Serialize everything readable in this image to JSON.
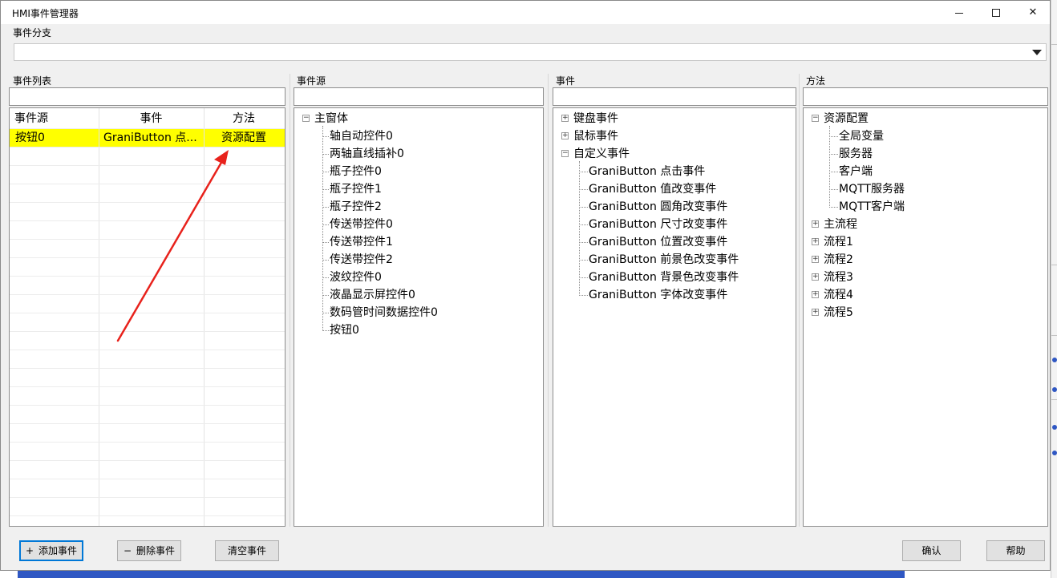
{
  "window": {
    "title": "HMI事件管理器",
    "minimize_icon": "minimize-icon",
    "maximize_icon": "maximize-icon",
    "close_icon": "close-icon",
    "close_glyph": "✕"
  },
  "branch": {
    "label": "事件分支",
    "value": ""
  },
  "event_list": {
    "label": "事件列表",
    "filter_value": "",
    "columns": [
      "事件源",
      "事件",
      "方法"
    ],
    "rows": [
      [
        "按钮0",
        "GraniButton 点...",
        "资源配置"
      ]
    ],
    "selected_row_color": "#ffff00"
  },
  "source": {
    "label": "事件源",
    "filter_value": "",
    "root": "主窗体",
    "root_expander": "−",
    "children": [
      "轴自动控件0",
      "两轴直线插补0",
      "瓶子控件0",
      "瓶子控件1",
      "瓶子控件2",
      "传送带控件0",
      "传送带控件1",
      "传送带控件2",
      "波纹控件0",
      "液晶显示屏控件0",
      "数码管时间数据控件0",
      "按钮0"
    ]
  },
  "events": {
    "label": "事件",
    "filter_value": "",
    "groups": [
      {
        "label": "键盘事件",
        "expander": "+"
      },
      {
        "label": "鼠标事件",
        "expander": "+"
      },
      {
        "label": "自定义事件",
        "expander": "−"
      }
    ],
    "custom_children": [
      "GraniButton 点击事件",
      "GraniButton 值改变事件",
      "GraniButton 圆角改变事件",
      "GraniButton 尺寸改变事件",
      "GraniButton 位置改变事件",
      "GraniButton 前景色改变事件",
      "GraniButton 背景色改变事件",
      "GraniButton 字体改变事件"
    ]
  },
  "methods": {
    "label": "方法",
    "filter_value": "",
    "root": "资源配置",
    "root_expander": "−",
    "resource_children": [
      "全局变量",
      "服务器",
      "客户端",
      "MQTT服务器",
      "MQTT客户端"
    ],
    "flows": [
      "主流程",
      "流程1",
      "流程2",
      "流程3",
      "流程4",
      "流程5"
    ],
    "flow_expander": "+"
  },
  "buttons": {
    "add_prefix": "+",
    "add": "添加事件",
    "delete_prefix": "−",
    "delete": "删除事件",
    "clear": "清空事件",
    "confirm": "确认",
    "help": "帮助"
  },
  "colors": {
    "selection": "#ffff00",
    "annotation_arrow": "#e8221c",
    "focus_border": "#0078d7"
  }
}
